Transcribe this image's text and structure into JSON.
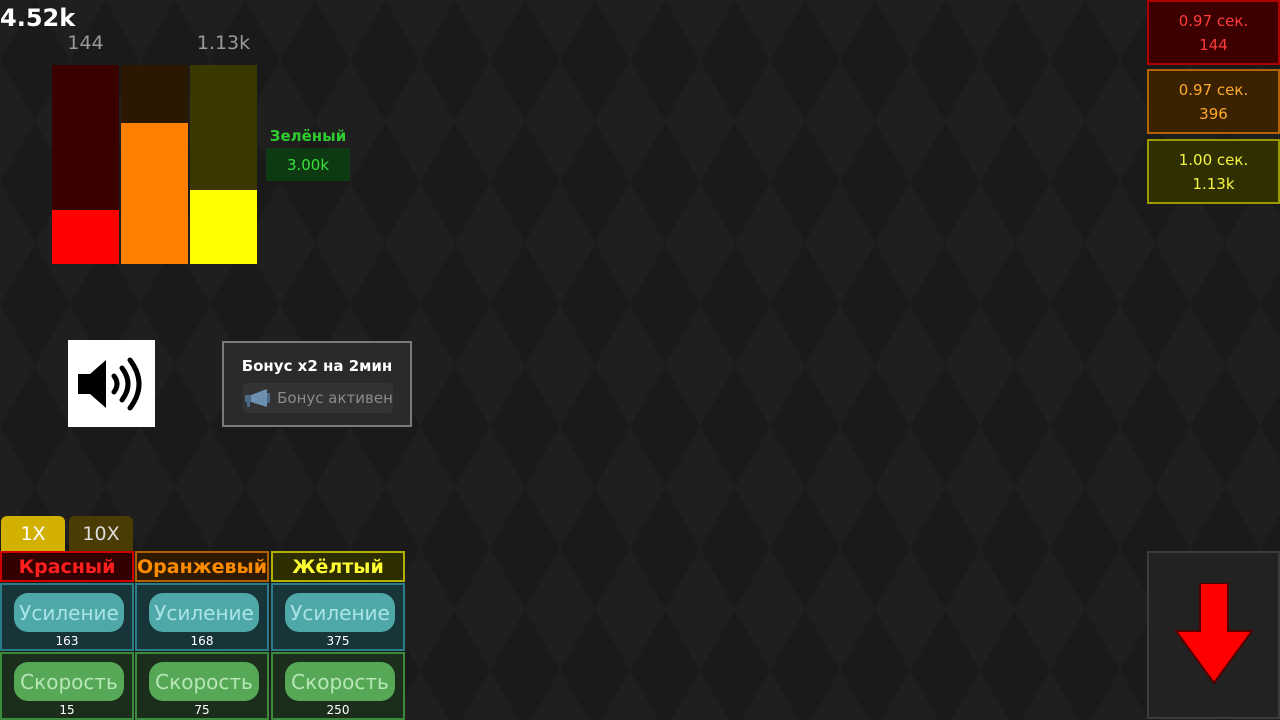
{
  "total": "4.52k",
  "bars": [
    {
      "top_label": "144",
      "fill": 0.27,
      "bg_color": "#3a0000",
      "fill_color": "#ff0000"
    },
    {
      "top_label": "",
      "fill": 0.71,
      "bg_color": "#2a1800",
      "fill_color": "#ff8000"
    },
    {
      "top_label": "1.13k",
      "fill": 0.37,
      "bg_color": "#3a3800",
      "fill_color": "#ffff00"
    }
  ],
  "green": {
    "label": "Зелёный",
    "value": "3.00k"
  },
  "sound": {
    "icon": "speaker-icon"
  },
  "bonus": {
    "title": "Бонус x2 на 2мин",
    "status": "Бонус активен",
    "icon": "megaphone-icon"
  },
  "timers": [
    {
      "time": "0.97 сек.",
      "value": "144",
      "color": "#ff3b3b"
    },
    {
      "time": "0.97 сек.",
      "value": "396",
      "color": "#ffa92b"
    },
    {
      "time": "1.00 сек.",
      "value": "1.13k",
      "color": "#f5f544"
    }
  ],
  "tabs": [
    {
      "label": "1X",
      "active": true
    },
    {
      "label": "10X",
      "active": false
    }
  ],
  "columns": [
    {
      "name": "Красный",
      "boost_label": "Усиление",
      "boost_count": "163",
      "speed_label": "Скорость",
      "speed_count": "15"
    },
    {
      "name": "Оранжевый",
      "boost_label": "Усиление",
      "boost_count": "168",
      "speed_label": "Скорость",
      "speed_count": "75"
    },
    {
      "name": "Жёлтый",
      "boost_label": "Усиление",
      "boost_count": "375",
      "speed_label": "Скорость",
      "speed_count": "250"
    }
  ],
  "drop": {
    "icon": "arrow-down-icon",
    "color": "#ff0000"
  }
}
